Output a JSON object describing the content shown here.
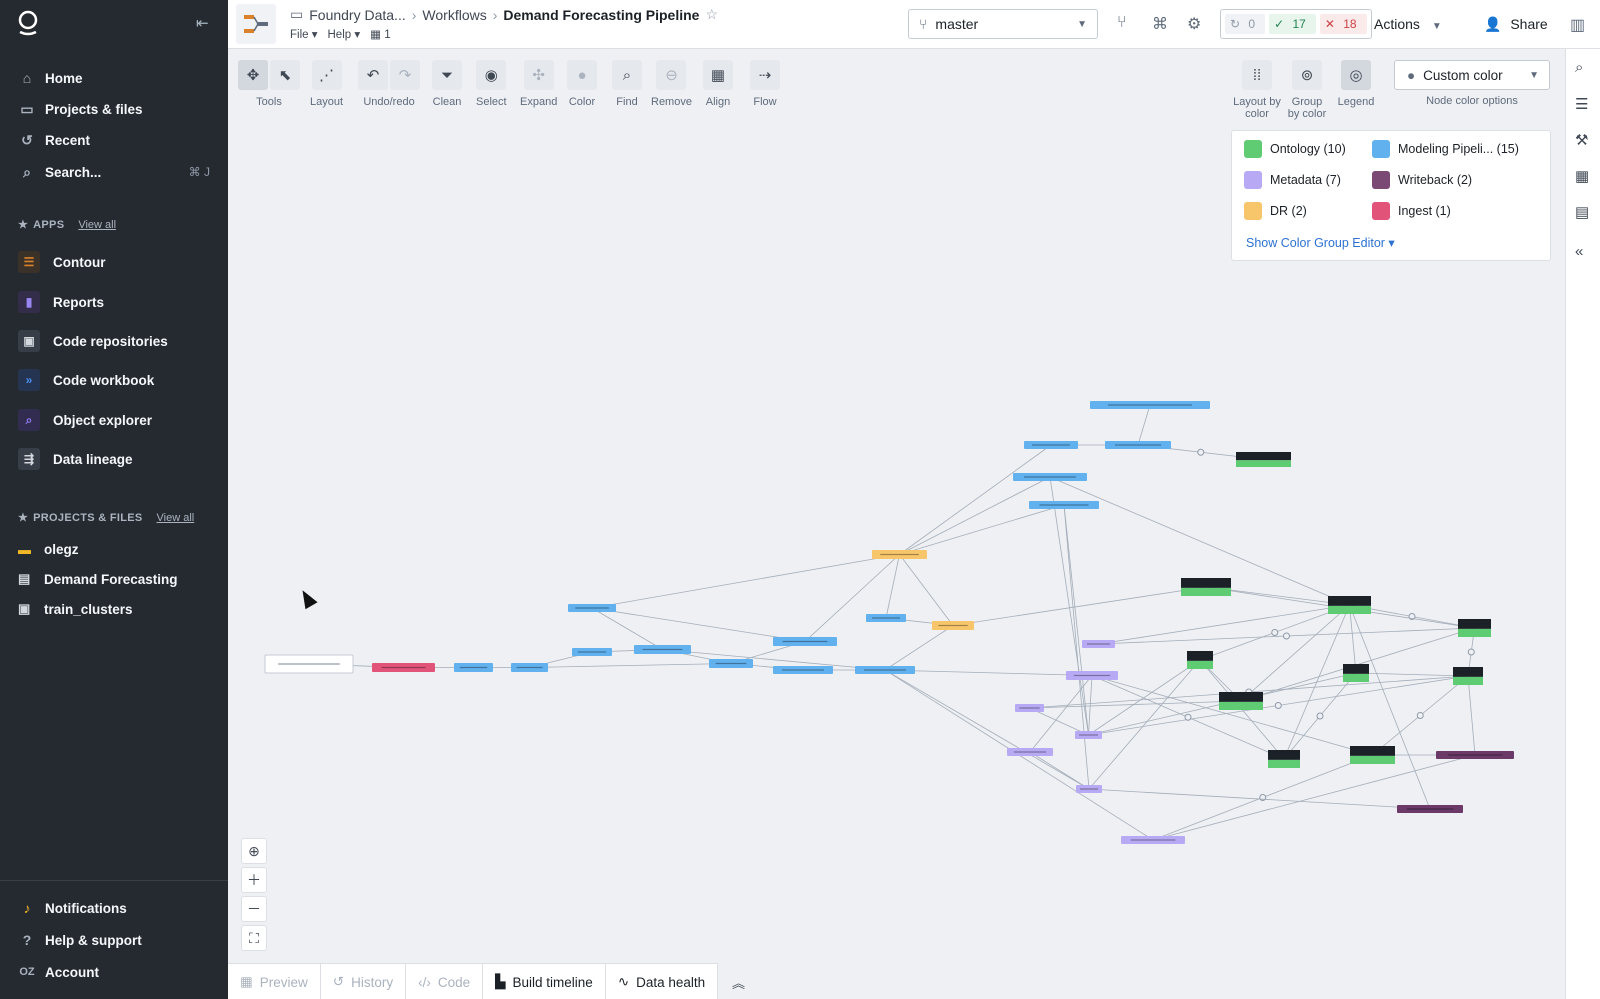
{
  "sidebar": {
    "nav": [
      {
        "label": "Home",
        "icon": "home-icon"
      },
      {
        "label": "Projects & files",
        "icon": "folder-icon"
      },
      {
        "label": "Recent",
        "icon": "history-icon"
      },
      {
        "label": "Search...",
        "icon": "search-icon",
        "shortcut": "⌘ J"
      }
    ],
    "apps_heading": "APPS",
    "apps_view_all": "View all",
    "apps": [
      {
        "label": "Contour",
        "color": "#d9822b",
        "icon": "contour-icon"
      },
      {
        "label": "Reports",
        "color": "#7961db",
        "icon": "reports-icon"
      },
      {
        "label": "Code repositories",
        "color": "#5f6b7c",
        "icon": "code-repo-icon"
      },
      {
        "label": "Code workbook",
        "color": "#2d72d2",
        "icon": "code-workbook-icon"
      },
      {
        "label": "Object explorer",
        "color": "#634dbf",
        "icon": "object-explorer-icon"
      },
      {
        "label": "Data lineage",
        "color": "#5f6b7c",
        "icon": "data-lineage-icon"
      }
    ],
    "projects_heading": "PROJECTS & FILES",
    "projects_view_all": "View all",
    "projects": [
      {
        "label": "olegz",
        "icon": "folder-icon"
      },
      {
        "label": "Demand Forecasting",
        "icon": "document-icon"
      },
      {
        "label": "train_clusters",
        "icon": "code-repo-icon"
      }
    ],
    "footer": [
      {
        "label": "Notifications",
        "icon": "bell-icon"
      },
      {
        "label": "Help & support",
        "icon": "help-icon"
      },
      {
        "label": "Account",
        "icon": "OZ"
      }
    ]
  },
  "header": {
    "breadcrumbs": [
      "Foundry Data...",
      "Workflows",
      "Demand Forecasting Pipeline"
    ],
    "menus": [
      "File ▾",
      "Help ▾"
    ],
    "count": "1",
    "branch": "master",
    "checks": {
      "running": "0",
      "success": "17",
      "failed": "18"
    },
    "actions_label": "Actions",
    "share_label": "Share"
  },
  "toolbar": [
    {
      "label": "Tools"
    },
    {
      "label": "Layout"
    },
    {
      "label": "Undo/redo"
    },
    {
      "label": "Clean"
    },
    {
      "label": "Select"
    },
    {
      "label": "Expand"
    },
    {
      "label": "Color"
    },
    {
      "label": "Find"
    },
    {
      "label": "Remove"
    },
    {
      "label": "Align"
    },
    {
      "label": "Flow"
    }
  ],
  "color_tools": {
    "layout_by_color": "Layout by color",
    "group_by_color": "Group by color",
    "legend": "Legend",
    "select_value": "Custom color",
    "select_label": "Node color options"
  },
  "legend": {
    "items": [
      {
        "label": "Ontology (10)",
        "color": "#5fcb73"
      },
      {
        "label": "Modeling Pipeli... (15)",
        "color": "#61b1ef"
      },
      {
        "label": "Metadata (7)",
        "color": "#b8a9f5"
      },
      {
        "label": "Writeback (2)",
        "color": "#7a4a74"
      },
      {
        "label": "DR (2)",
        "color": "#f7c66a"
      },
      {
        "label": "Ingest (1)",
        "color": "#e2537a"
      }
    ],
    "editor_link": "Show Color Group Editor ▾"
  },
  "bottom_tabs": [
    {
      "label": "Preview",
      "dim": true
    },
    {
      "label": "History",
      "dim": true
    },
    {
      "label": "Code",
      "dim": true
    },
    {
      "label": "Build timeline",
      "dim": false
    },
    {
      "label": "Data health",
      "dim": false
    }
  ]
}
